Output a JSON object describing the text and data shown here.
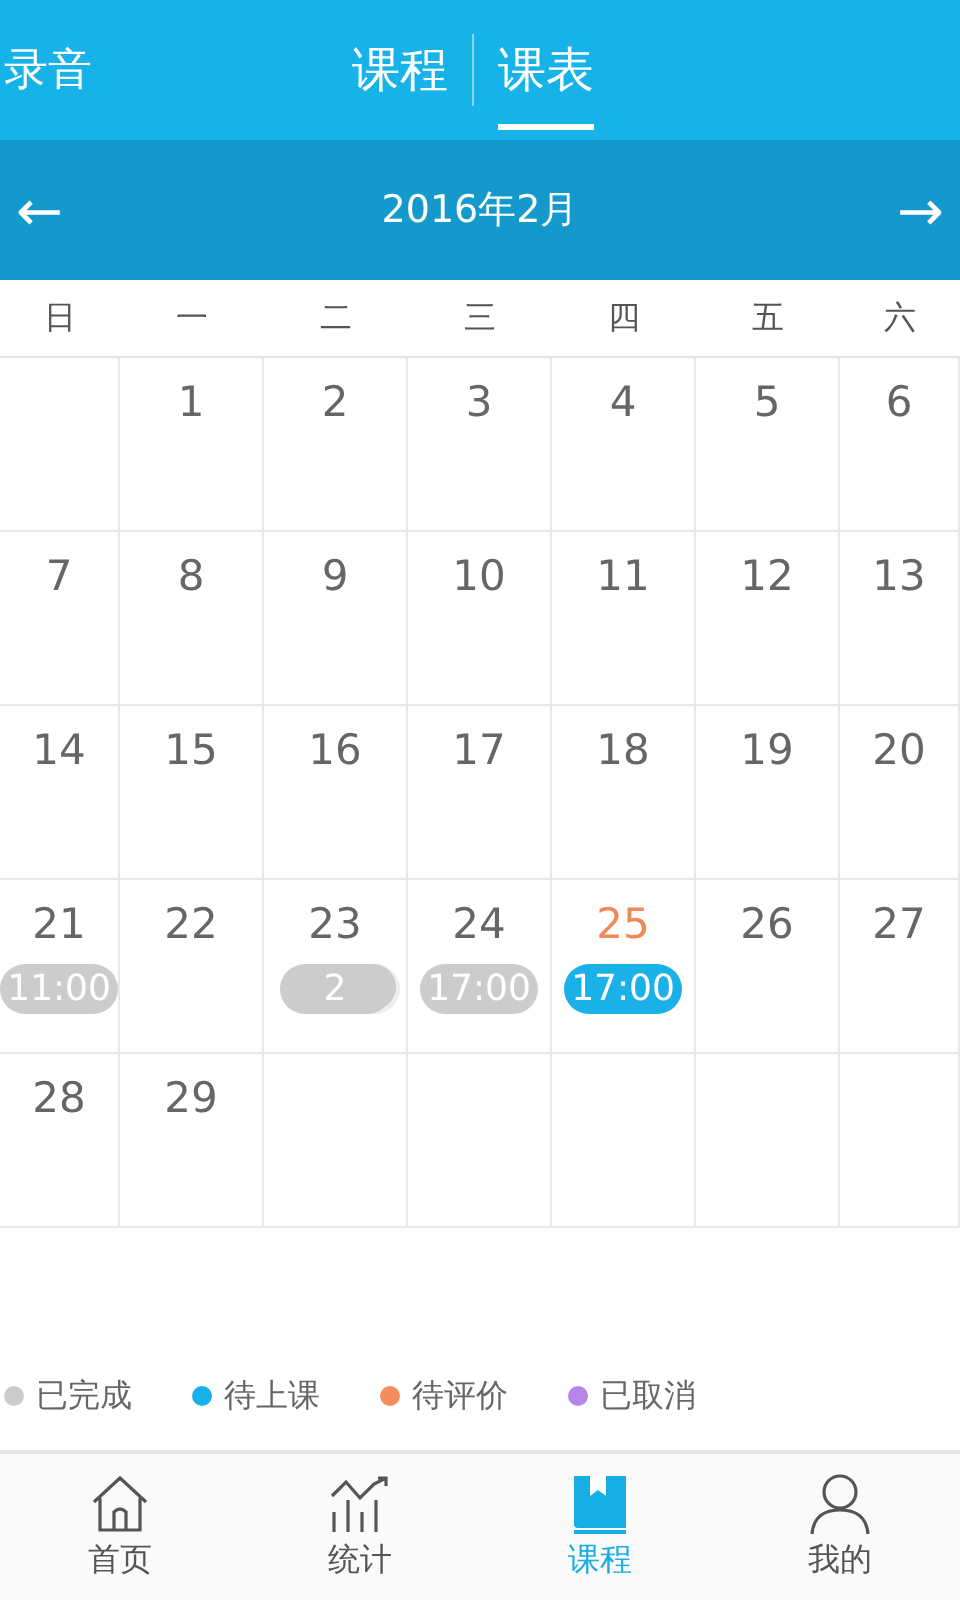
{
  "header": {
    "left_link": "录音",
    "tabs": [
      {
        "label": "课程",
        "selected": false
      },
      {
        "label": "课表",
        "selected": true
      }
    ]
  },
  "month_bar": {
    "prev": "←",
    "title": "2016年2月",
    "next": "→"
  },
  "weekdays": [
    "日",
    "一",
    "二",
    "三",
    "四",
    "五",
    "六"
  ],
  "weeks": [
    [
      {
        "kind": "empty"
      },
      {
        "kind": "day",
        "day": "1",
        "highlight": false
      },
      {
        "kind": "day",
        "day": "2",
        "highlight": false
      },
      {
        "kind": "day",
        "day": "3",
        "highlight": false
      },
      {
        "kind": "day",
        "day": "4",
        "highlight": false
      },
      {
        "kind": "day",
        "day": "5",
        "highlight": false
      },
      {
        "kind": "day",
        "day": "6",
        "highlight": false
      }
    ],
    [
      {
        "kind": "day",
        "day": "7",
        "highlight": false
      },
      {
        "kind": "day",
        "day": "8",
        "highlight": false
      },
      {
        "kind": "day",
        "day": "9",
        "highlight": false
      },
      {
        "kind": "day",
        "day": "10",
        "highlight": false
      },
      {
        "kind": "day",
        "day": "11",
        "highlight": false
      },
      {
        "kind": "day",
        "day": "12",
        "highlight": false
      },
      {
        "kind": "day",
        "day": "13",
        "highlight": false
      }
    ],
    [
      {
        "kind": "day",
        "day": "14",
        "highlight": false
      },
      {
        "kind": "day",
        "day": "15",
        "highlight": false
      },
      {
        "kind": "day",
        "day": "16",
        "highlight": false
      },
      {
        "kind": "day",
        "day": "17",
        "highlight": false
      },
      {
        "kind": "day",
        "day": "18",
        "highlight": false
      },
      {
        "kind": "day",
        "day": "19",
        "highlight": false
      },
      {
        "kind": "day",
        "day": "20",
        "highlight": false
      }
    ],
    [
      {
        "kind": "day",
        "day": "21",
        "highlight": false,
        "event": {
          "text": "11:00",
          "color": "#cccccc",
          "kind": "single"
        }
      },
      {
        "kind": "day",
        "day": "22",
        "highlight": false
      },
      {
        "kind": "day",
        "day": "23",
        "highlight": false,
        "event": {
          "text": "2",
          "color": "#cccccc",
          "kind": "stack"
        }
      },
      {
        "kind": "day",
        "day": "24",
        "highlight": false,
        "event": {
          "text": "17:00",
          "color": "#cccccc",
          "kind": "single"
        }
      },
      {
        "kind": "day",
        "day": "25",
        "highlight": true,
        "event": {
          "text": "17:00",
          "color": "#1ab0e8",
          "kind": "single"
        }
      },
      {
        "kind": "day",
        "day": "26",
        "highlight": false
      },
      {
        "kind": "day",
        "day": "27",
        "highlight": false
      }
    ],
    [
      {
        "kind": "day",
        "day": "28",
        "highlight": false
      },
      {
        "kind": "day",
        "day": "29",
        "highlight": false
      },
      {
        "kind": "empty"
      },
      {
        "kind": "empty"
      },
      {
        "kind": "empty"
      },
      {
        "kind": "empty"
      },
      {
        "kind": "empty"
      }
    ]
  ],
  "legend": [
    {
      "label": "已完成",
      "color": "#cccccc"
    },
    {
      "label": "待上课",
      "color": "#1ab0e8"
    },
    {
      "label": "待评价",
      "color": "#f58c5a"
    },
    {
      "label": "已取消",
      "color": "#b784e8"
    }
  ],
  "bottom_nav": [
    {
      "label": "首页",
      "selected": false
    },
    {
      "label": "统计",
      "selected": false
    },
    {
      "label": "课程",
      "selected": true
    },
    {
      "label": "我的",
      "selected": false
    }
  ]
}
